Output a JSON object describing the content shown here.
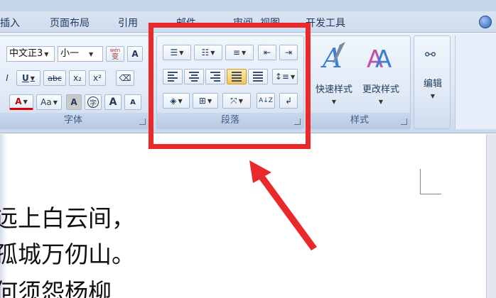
{
  "menu": {
    "tabs": [
      "插入",
      "页面布局",
      "引用",
      "邮件",
      "审阅",
      "视图",
      "开发工具"
    ]
  },
  "font_group": {
    "label": "字体",
    "font_name": "中文正3",
    "font_size": "小一",
    "wen_label": "wén\n变",
    "underline": "U",
    "strike": "abc",
    "sub": "x₂",
    "sup": "x²",
    "change_case": "Aa",
    "char_shade": "A",
    "enclose": "字",
    "grow": "A",
    "shrink": "A",
    "font_color": "A",
    "italic": "I"
  },
  "paragraph_group": {
    "label": "段落",
    "sort_label": "A↓Z"
  },
  "styles_group": {
    "label": "样式",
    "quick_styles": "快速样式",
    "change_styles": "更改样式"
  },
  "edit_group": {
    "label": "编辑"
  },
  "document": {
    "lines": [
      "远上白云间，",
      "孤城万仞山。",
      "何须怨杨柳"
    ]
  },
  "colors": {
    "highlight": "#ea2a2a",
    "accent_text": "#1e395b"
  }
}
